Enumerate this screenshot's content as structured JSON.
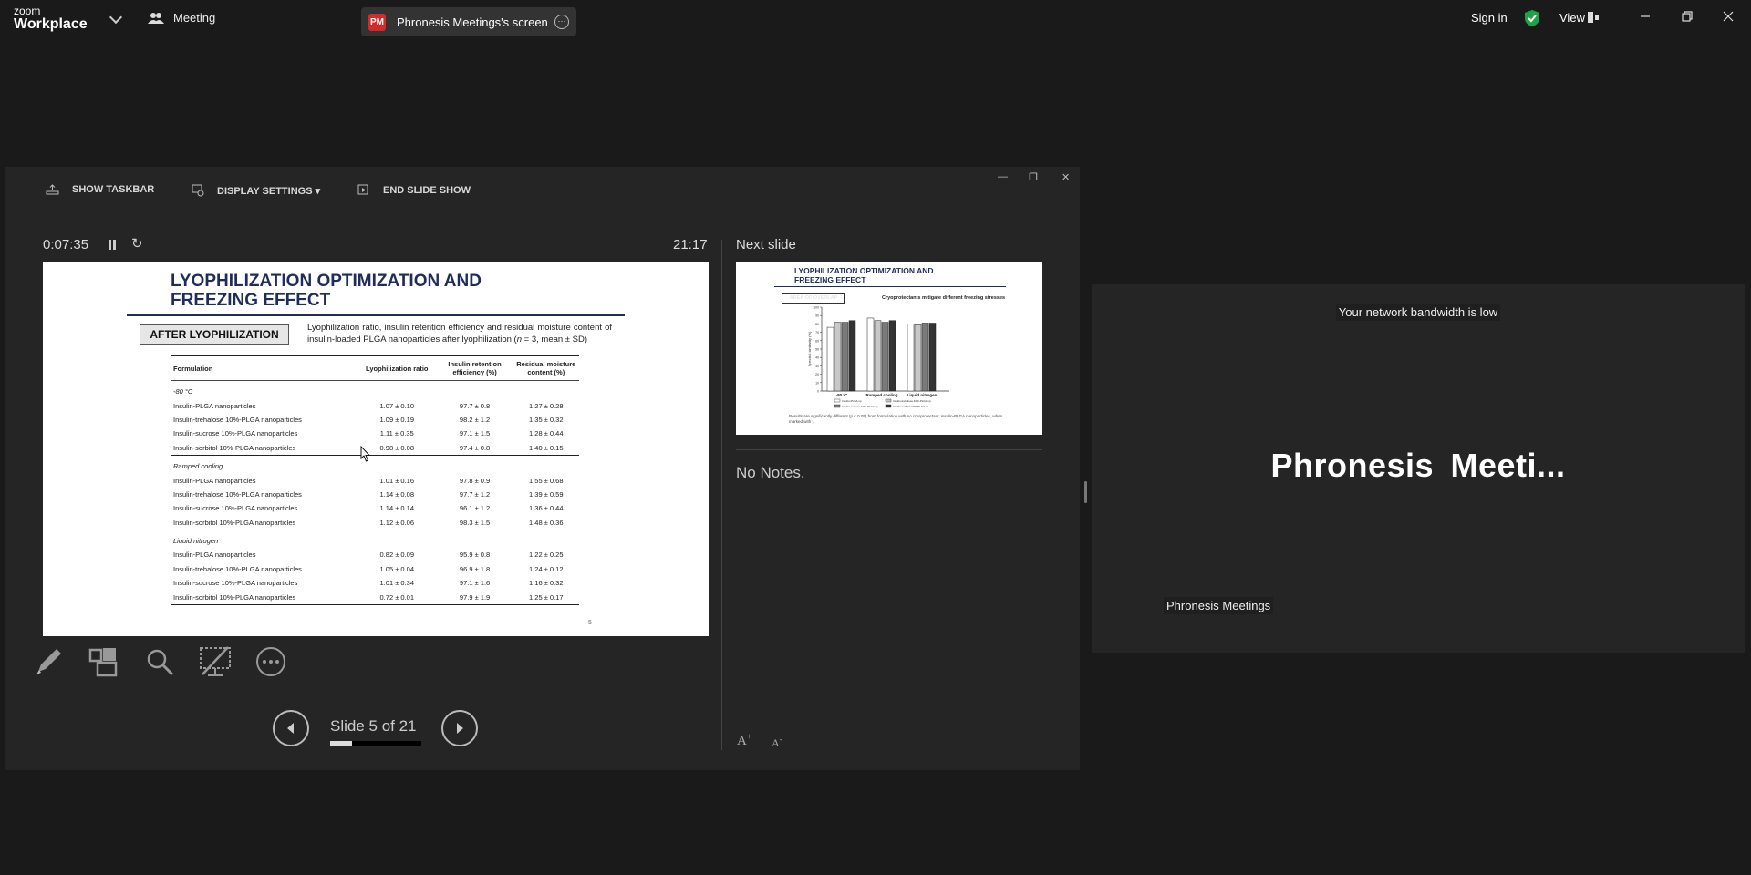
{
  "app": {
    "logo_line1": "zoom",
    "logo_line2": "Workplace",
    "meeting_label": "Meeting",
    "share_badge": "PM",
    "share_title": "Phronesis Meetings's screen",
    "sign_in": "Sign in",
    "view_label": "View"
  },
  "presenter": {
    "toolbar": {
      "show_taskbar": "SHOW TASKBAR",
      "display_settings": "DISPLAY SETTINGS ▾",
      "end_show": "END SLIDE SHOW"
    },
    "elapsed": "0:07:35",
    "clock": "21:17",
    "next_slide_label": "Next slide",
    "notes": "No Notes.",
    "slide_counter": "Slide 5 of 21",
    "slide_progress": 0.238
  },
  "slide": {
    "title_line1": "LYOPHILIZATION OPTIMIZATION AND",
    "title_line2": "FREEZING EFFECT",
    "badge": "AFTER LYOPHILIZATION",
    "caption_pre": "Lyophilization ratio, insulin retention efficiency and residual moisture content of insulin-loaded PLGA nanoparticles after lyophilization (",
    "caption_n": "n",
    "caption_post": " = 3, mean ± SD)",
    "page_number": "5",
    "table": {
      "headers": [
        "Formulation",
        "Lyophilization ratio",
        "Insulin retention efficiency (%)",
        "Residual moisture content (%)"
      ],
      "groups": [
        {
          "name": "-80 °C",
          "rows": [
            [
              "Insulin-PLGA nanoparticles",
              "1.07 ± 0.10",
              "97.7 ± 0.8",
              "1.27 ± 0.28"
            ],
            [
              "Insulin-trehalose 10%-PLGA nanoparticles",
              "1.09 ± 0.19",
              "98.2 ± 1.2",
              "1.35 ± 0.32"
            ],
            [
              "Insulin-sucrose 10%-PLGA nanoparticles",
              "1.11 ± 0.35",
              "97.1 ± 1.5",
              "1.28 ± 0.44"
            ],
            [
              "Insulin-sorbitol 10%-PLGA nanoparticles",
              "0.98 ± 0.08",
              "97.4 ± 0.8",
              "1.40 ± 0.15"
            ]
          ]
        },
        {
          "name": "Ramped cooling",
          "rows": [
            [
              "Insulin-PLGA nanoparticles",
              "1.01 ± 0.16",
              "97.8 ± 0.9",
              "1.55 ± 0.68"
            ],
            [
              "Insulin-trehalose 10%-PLGA nanoparticles",
              "1.14 ± 0.08",
              "97.7 ± 1.2",
              "1.39 ± 0.59"
            ],
            [
              "Insulin-sucrose 10%-PLGA nanoparticles",
              "1.14 ± 0.14",
              "96.1 ± 1.2",
              "1.36 ± 0.44"
            ],
            [
              "Insulin-sorbitol 10%-PLGA nanoparticles",
              "1.12 ± 0.06",
              "98.3 ± 1.5",
              "1.48 ± 0.36"
            ]
          ]
        },
        {
          "name": "Liquid nitrogen",
          "rows": [
            [
              "Insulin-PLGA nanoparticles",
              "0.82 ± 0.09",
              "95.9 ± 0.8",
              "1.22 ± 0.25"
            ],
            [
              "Insulin-trehalose 10%-PLGA nanoparticles",
              "1.05 ± 0.04",
              "96.9 ± 1.8",
              "1.24 ± 0.12"
            ],
            [
              "Insulin-sucrose 10%-PLGA nanoparticles",
              "1.01 ± 0.34",
              "97.1 ± 1.6",
              "1.16 ± 0.32"
            ],
            [
              "Insulin-sorbitol 10%-PLGA nanoparticles",
              "0.72 ± 0.01",
              "97.9 ± 1.9",
              "1.25 ± 0.17"
            ]
          ]
        }
      ]
    }
  },
  "next_slide": {
    "title_line1": "LYOPHILIZATION OPTIMIZATION AND",
    "title_line2": "FREEZING EFFECT",
    "badge": "AREA OF OVERLAP",
    "subtitle": "Cryoprotectants mitigate different freezing stresses",
    "y_axis_label": "Spectral similarity (%)",
    "categories": [
      "-80 °C",
      "Ramped cooling",
      "Liquid nitrogen"
    ],
    "legend_1": "Insulin-PLGA np",
    "legend_2": "Insulin-trehalose 10%-PLGA np",
    "legend_3": "Insulin-sucrose 10%-PLGA np",
    "legend_4": "Insulin-sorbitol 10%-PLGA np",
    "footnote": "Results are significantly different (p < 0.05) from formulation with no cryoprotectant; insulin-PLGA nanoparticles, when marked with *.",
    "bar_values": [
      [
        76,
        82,
        82,
        84
      ],
      [
        87,
        84,
        82,
        84
      ],
      [
        80,
        79,
        81,
        81
      ]
    ]
  },
  "participant": {
    "network_warning": "Your network bandwidth is low",
    "display_name": "Phronesis  Meeti...",
    "name_label": "Phronesis Meetings"
  }
}
